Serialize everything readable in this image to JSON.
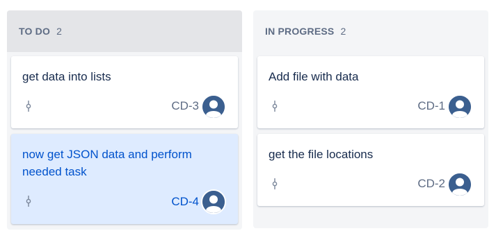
{
  "columns": [
    {
      "title": "TO DO",
      "count": "2",
      "cards": [
        {
          "summary": "get data into lists",
          "key": "CD-3",
          "icon": "story-point-icon",
          "assignee_icon": "user-avatar-icon"
        },
        {
          "summary": "now get JSON data and perform needed task",
          "key": "CD-4",
          "icon": "story-point-icon",
          "assignee_icon": "user-avatar-icon",
          "selected": true
        }
      ]
    },
    {
      "title": "IN PROGRESS",
      "count": "2",
      "cards": [
        {
          "summary": "Add file with data",
          "key": "CD-1",
          "icon": "story-point-icon",
          "assignee_icon": "user-avatar-icon"
        },
        {
          "summary": "get the file locations",
          "key": "CD-2",
          "icon": "story-point-icon",
          "assignee_icon": "user-avatar-icon"
        }
      ]
    }
  ],
  "colors": {
    "column_bg": "#f4f5f7",
    "todo_header_bg": "#e4e5e8",
    "selected_card_bg": "#deebff",
    "selected_text": "#0052cc",
    "avatar": "#3b5f8f"
  }
}
